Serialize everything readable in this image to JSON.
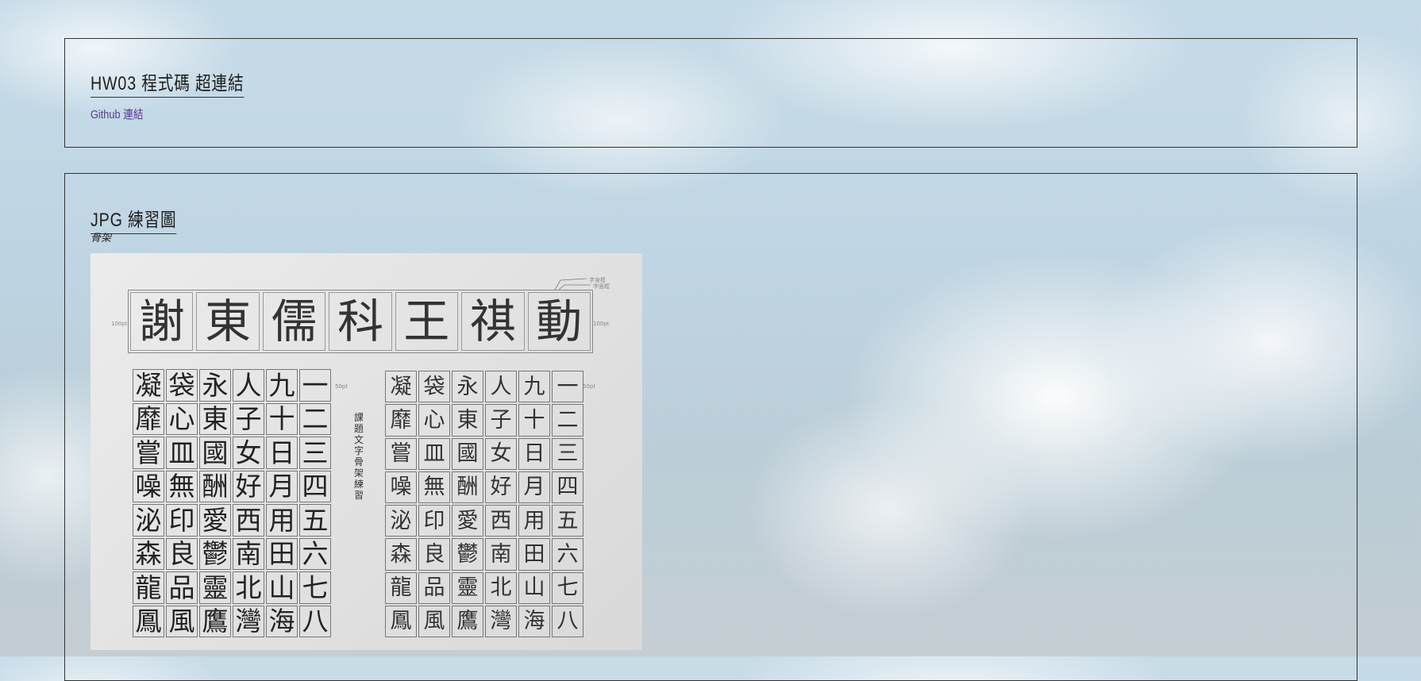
{
  "section1": {
    "title": "HW03 程式碼 超連結",
    "link_label": "Github 連結"
  },
  "section2": {
    "title": "JPG 練習圖",
    "subtitle": "骨架",
    "photo": {
      "header_chars": [
        "謝",
        "東",
        "儒",
        "科",
        "王",
        "祺",
        "動"
      ],
      "labels": {
        "pt100": "100pt",
        "pt50": "50pt",
        "legend_a": "字身框",
        "legend_b": "字面框"
      },
      "note": "課題 文字骨架練習",
      "grid_chars": [
        "凝",
        "袋",
        "永",
        "人",
        "九",
        "一",
        "靡",
        "心",
        "東",
        "子",
        "十",
        "二",
        "嘗",
        "皿",
        "國",
        "女",
        "日",
        "三",
        "噪",
        "無",
        "酬",
        "好",
        "月",
        "四",
        "泌",
        "印",
        "愛",
        "西",
        "用",
        "五",
        "森",
        "良",
        "鬱",
        "南",
        "田",
        "六",
        "龍",
        "品",
        "靈",
        "北",
        "山",
        "七",
        "鳳",
        "風",
        "鷹",
        "灣",
        "海",
        "八"
      ]
    }
  }
}
